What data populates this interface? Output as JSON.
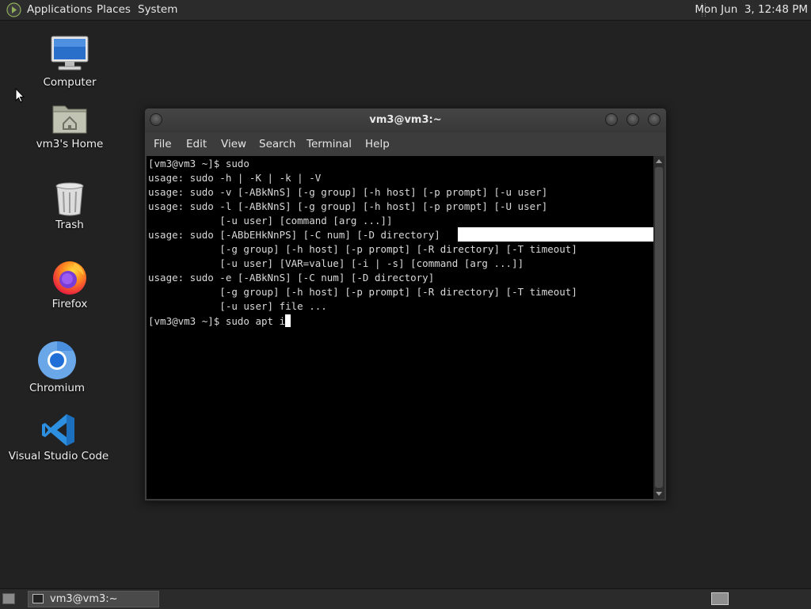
{
  "top_panel": {
    "menus": [
      "Applications",
      "Places",
      "System"
    ],
    "clock": "Mon Jun  3, 12:48 PM"
  },
  "desktop_icons": [
    {
      "label": "Computer",
      "icon": "computer-icon"
    },
    {
      "label": "vm3's Home",
      "icon": "home-folder-icon"
    },
    {
      "label": "Trash",
      "icon": "trash-icon"
    },
    {
      "label": "Firefox",
      "icon": "firefox-icon"
    },
    {
      "label": "Chromium",
      "icon": "chromium-icon"
    },
    {
      "label": "Visual Studio Code",
      "icon": "vscode-icon"
    }
  ],
  "terminal": {
    "title": "vm3@vm3:~",
    "menu": [
      "File",
      "Edit",
      "View",
      "Search",
      "Terminal",
      "Help"
    ],
    "lines": [
      "[vm3@vm3 ~]$ sudo",
      "usage: sudo -h | -K | -k | -V",
      "usage: sudo -v [-ABkNnS] [-g group] [-h host] [-p prompt] [-u user]",
      "usage: sudo -l [-ABkNnS] [-g group] [-h host] [-p prompt] [-U user]",
      "            [-u user] [command [arg ...]]",
      "usage: sudo [-ABbEHkNnPS] [-C num] [-D directory]",
      "            [-g group] [-h host] [-p prompt] [-R directory] [-T timeout]",
      "            [-u user] [VAR=value] [-i | -s] [command [arg ...]]",
      "usage: sudo -e [-ABkNnS] [-C num] [-D directory]",
      "            [-g group] [-h host] [-p prompt] [-R directory] [-T timeout]",
      "            [-u user] file ...",
      "[vm3@vm3 ~]$ sudo apt i"
    ]
  },
  "taskbar": {
    "task_label": "vm3@vm3:~"
  },
  "colors": {
    "desktop_bg": "#222222",
    "panel_bg": "#2b2b2b",
    "terminal_bg": "#000000",
    "terminal_fg": "#d9d9d9"
  }
}
